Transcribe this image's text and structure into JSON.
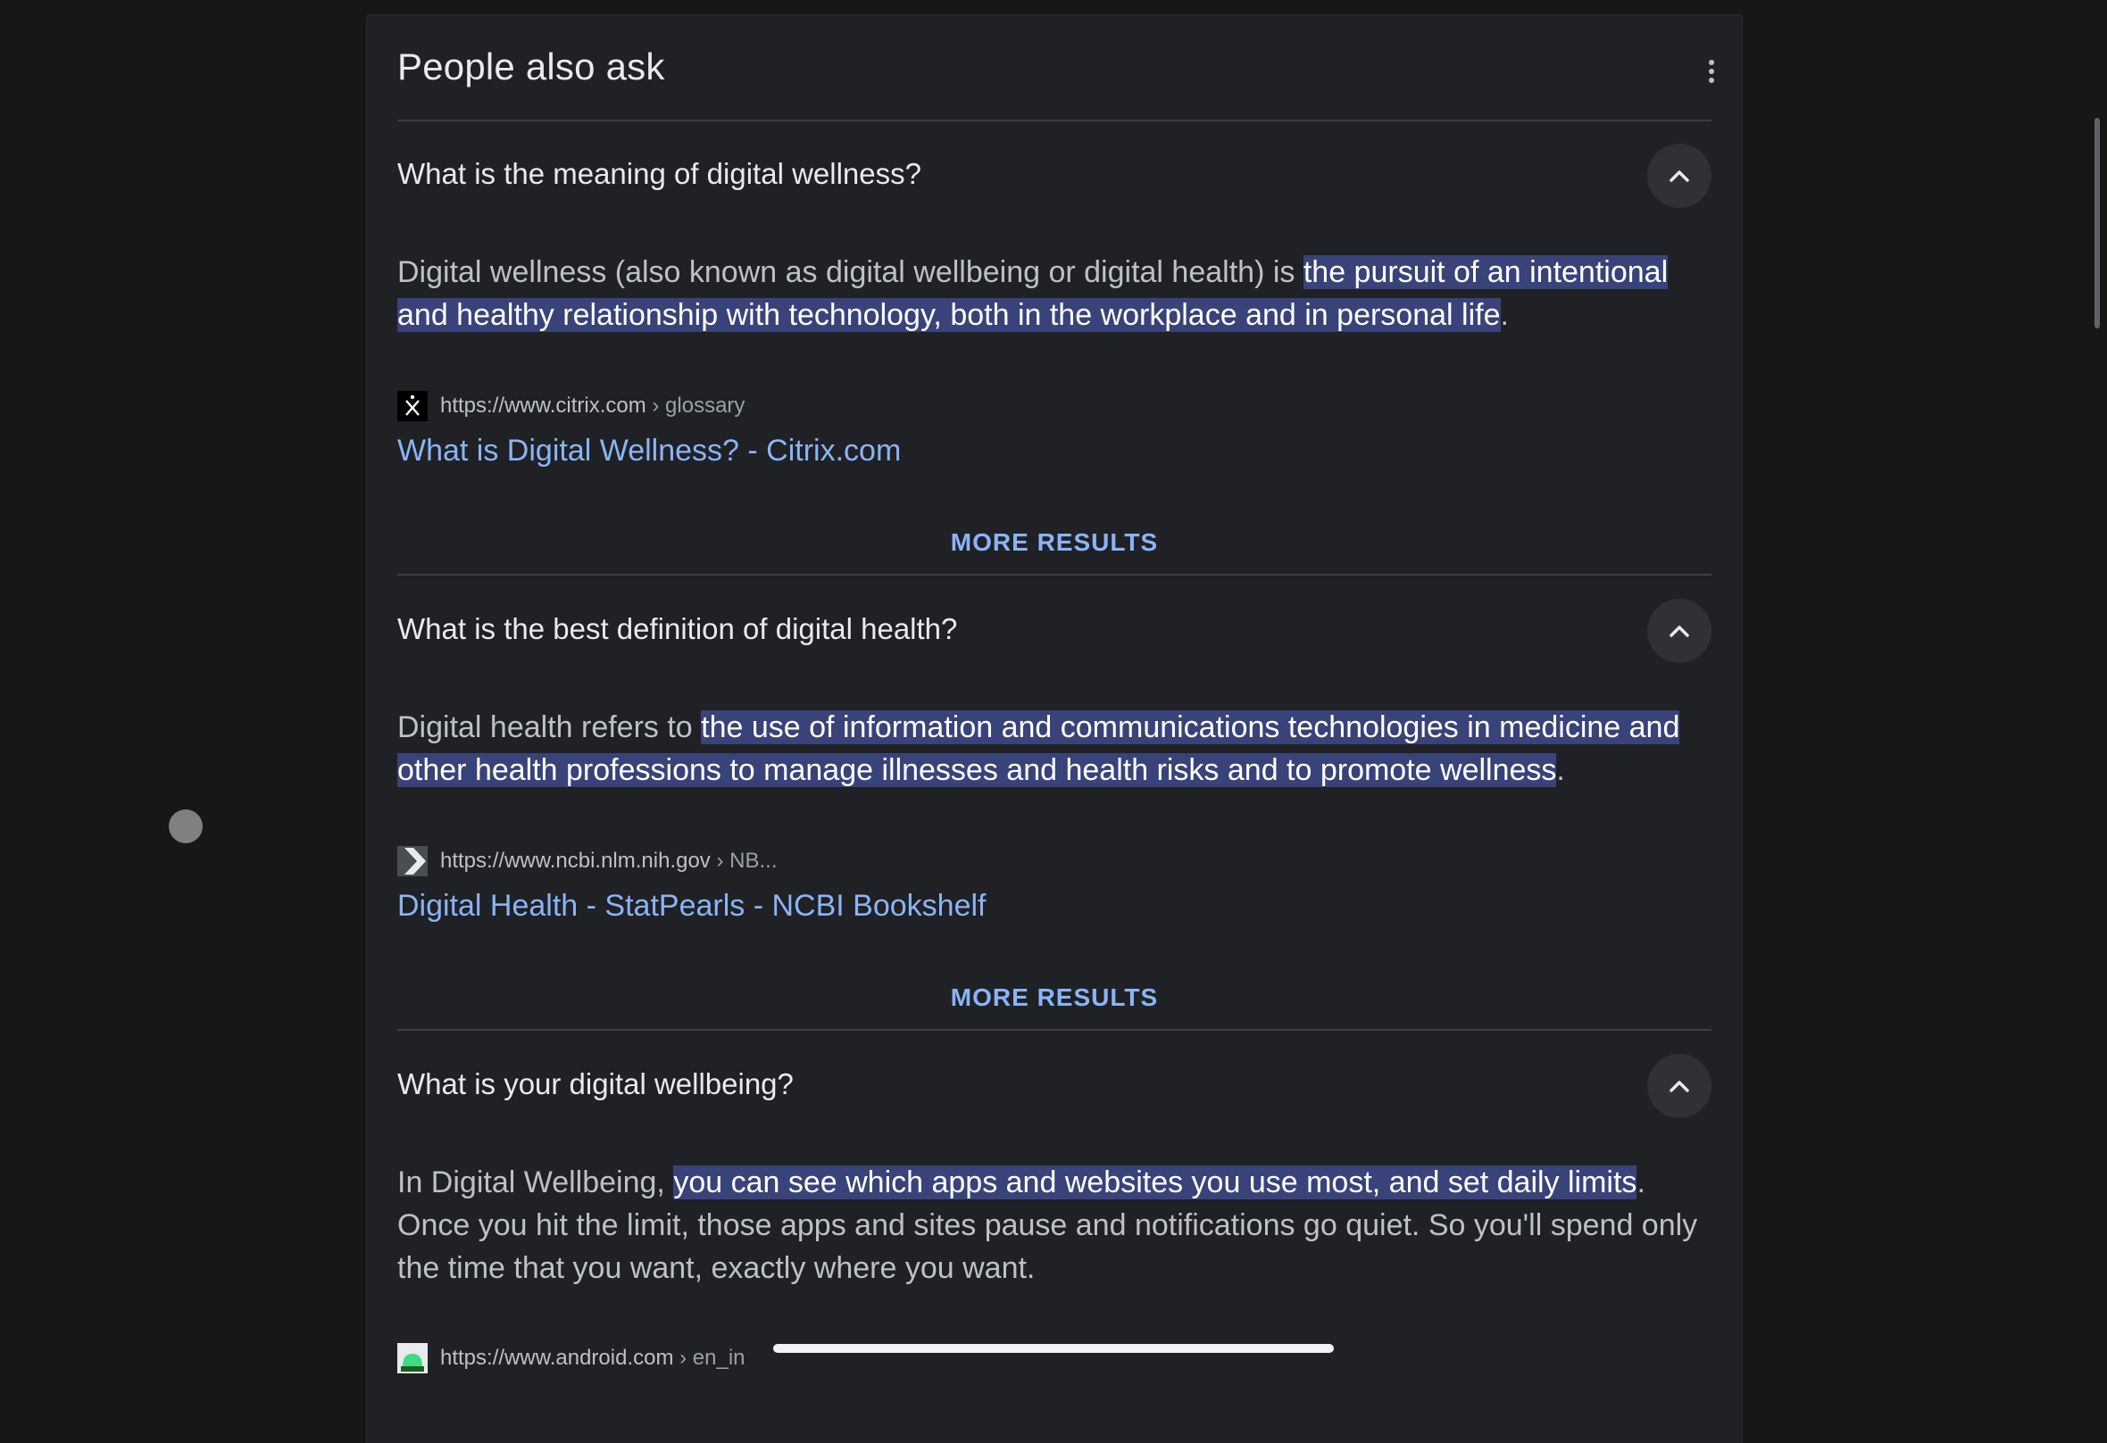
{
  "section": {
    "title": "People also ask"
  },
  "items": [
    {
      "question": "What is the meaning of digital wellness?",
      "answer_pre": "Digital wellness (also known as digital wellbeing or digital health) is ",
      "answer_highlight": "the pursuit of an intentional and healthy relationship with technology, both in the workplace and in personal life",
      "answer_post": ".",
      "source_url": "https://www.citrix.com",
      "source_crumb": " › glossary",
      "link_title": "What is Digital Wellness? - Citrix.com",
      "more_label": "MORE RESULTS",
      "favicon": "citrix-icon"
    },
    {
      "question": "What is the best definition of digital health?",
      "answer_pre": "Digital health refers to ",
      "answer_highlight": "the use of information and communications technologies in medicine and other health professions to manage illnesses and health risks and to promote wellness",
      "answer_post": ".",
      "source_url": "https://www.ncbi.nlm.nih.gov",
      "source_crumb": " › NB...",
      "link_title": "Digital Health - StatPearls - NCBI Bookshelf",
      "more_label": "MORE RESULTS",
      "favicon": "ncbi-icon"
    },
    {
      "question": "What is your digital wellbeing?",
      "answer_pre": "In Digital Wellbeing, ",
      "answer_highlight": "you can see which apps and websites you use most, and set daily limits",
      "answer_post": ". Once you hit the limit, those apps and sites pause and notifications go quiet. So you'll spend only the time that you want, exactly where you want.",
      "source_url": "https://www.android.com",
      "source_crumb": " › en_in",
      "favicon": "android-icon"
    }
  ],
  "colors": {
    "background": "#171717",
    "card": "#202124",
    "highlight": "#394379",
    "link": "#8ab4f8"
  }
}
